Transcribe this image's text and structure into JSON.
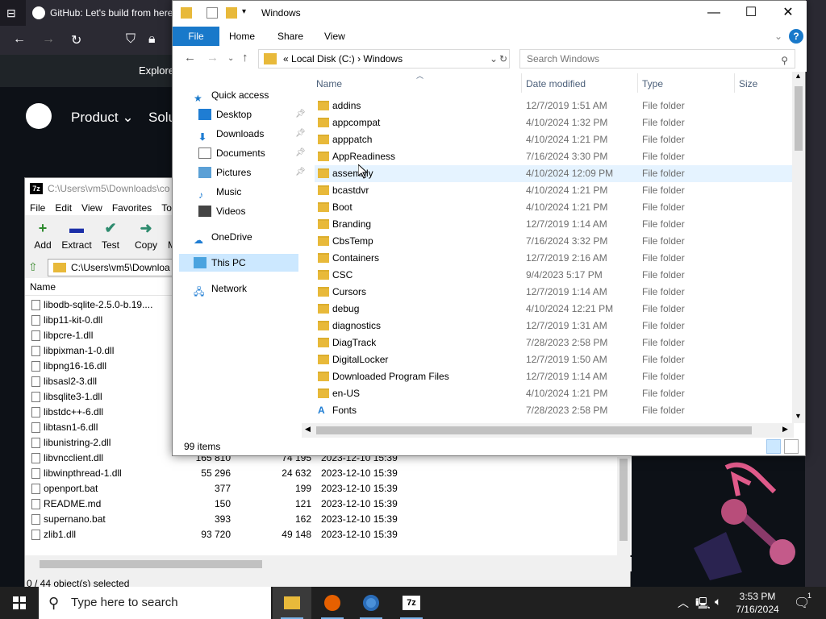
{
  "browser": {
    "tab_title": "GitHub: Let's build from here",
    "explore": "Explore",
    "product": "Product",
    "solutions": "Solu",
    "chevron": "⌄"
  },
  "sevenzip": {
    "title": "C:\\Users\\vm5\\Downloads\\co",
    "logo": "7z",
    "menu": [
      "File",
      "Edit",
      "View",
      "Favorites",
      "To"
    ],
    "tools": [
      {
        "label": "Add",
        "glyph": "+",
        "color": "#2e8b2e"
      },
      {
        "label": "Extract",
        "glyph": "▬",
        "color": "#1b2fa8"
      },
      {
        "label": "Test",
        "glyph": "✔",
        "color": "#2e8b6e"
      },
      {
        "label": "Copy",
        "glyph": "➜",
        "color": "#2e8b6e"
      },
      {
        "label": "M",
        "glyph": "",
        "color": "#000"
      }
    ],
    "path": "C:\\Users\\vm5\\Downloa",
    "column_name": "Name",
    "rows": [
      {
        "name": "libodb-sqlite-2.5.0-b.19....",
        "size": "",
        "packed": "",
        "date": ""
      },
      {
        "name": "libp11-kit-0.dll",
        "size": "",
        "packed": "",
        "date": ""
      },
      {
        "name": "libpcre-1.dll",
        "size": "",
        "packed": "",
        "date": ""
      },
      {
        "name": "libpixman-1-0.dll",
        "size": "",
        "packed": "",
        "date": ""
      },
      {
        "name": "libpng16-16.dll",
        "size": "",
        "packed": "",
        "date": ""
      },
      {
        "name": "libsasl2-3.dll",
        "size": "",
        "packed": "",
        "date": ""
      },
      {
        "name": "libsqlite3-1.dll",
        "size": "",
        "packed": "",
        "date": ""
      },
      {
        "name": "libstdc++-6.dll",
        "size": "",
        "packed": "",
        "date": ""
      },
      {
        "name": "libtasn1-6.dll",
        "size": "",
        "packed": "",
        "date": ""
      },
      {
        "name": "libunistring-2.dll",
        "size": "",
        "packed": "",
        "date": ""
      },
      {
        "name": "libvncclient.dll",
        "size": "165 810",
        "packed": "74 195",
        "date": "2023-12-10 15:39"
      },
      {
        "name": "libwinpthread-1.dll",
        "size": "55 296",
        "packed": "24 632",
        "date": "2023-12-10 15:39"
      },
      {
        "name": "openport.bat",
        "size": "377",
        "packed": "199",
        "date": "2023-12-10 15:39"
      },
      {
        "name": "README.md",
        "size": "150",
        "packed": "121",
        "date": "2023-12-10 15:39"
      },
      {
        "name": "supernano.bat",
        "size": "393",
        "packed": "162",
        "date": "2023-12-10 15:39"
      },
      {
        "name": "zlib1.dll",
        "size": "93 720",
        "packed": "49 148",
        "date": "2023-12-10 15:39"
      }
    ],
    "status": "0 / 44 object(s) selected"
  },
  "explorer": {
    "title": "Windows",
    "ribbon_tabs": {
      "file": "File",
      "home": "Home",
      "share": "Share",
      "view": "View"
    },
    "help": "?",
    "address": {
      "prefix": "«",
      "drive": "Local Disk (C:)",
      "sep": "›",
      "folder": "Windows"
    },
    "search_placeholder": "Search Windows",
    "nav": {
      "quick_access": "Quick access",
      "desktop": "Desktop",
      "downloads": "Downloads",
      "documents": "Documents",
      "pictures": "Pictures",
      "music": "Music",
      "videos": "Videos",
      "onedrive": "OneDrive",
      "this_pc": "This PC",
      "network": "Network"
    },
    "columns": {
      "name": "Name",
      "date": "Date modified",
      "type": "Type",
      "size": "Size"
    },
    "files": [
      {
        "name": "addins",
        "date": "12/7/2019 1:51 AM",
        "type": "File folder"
      },
      {
        "name": "appcompat",
        "date": "4/10/2024 1:32 PM",
        "type": "File folder"
      },
      {
        "name": "apppatch",
        "date": "4/10/2024 1:21 PM",
        "type": "File folder"
      },
      {
        "name": "AppReadiness",
        "date": "7/16/2024 3:30 PM",
        "type": "File folder"
      },
      {
        "name": "assembly",
        "date": "4/10/2024 12:09 PM",
        "type": "File folder"
      },
      {
        "name": "bcastdvr",
        "date": "4/10/2024 1:21 PM",
        "type": "File folder"
      },
      {
        "name": "Boot",
        "date": "4/10/2024 1:21 PM",
        "type": "File folder"
      },
      {
        "name": "Branding",
        "date": "12/7/2019 1:14 AM",
        "type": "File folder"
      },
      {
        "name": "CbsTemp",
        "date": "7/16/2024 3:32 PM",
        "type": "File folder"
      },
      {
        "name": "Containers",
        "date": "12/7/2019 2:16 AM",
        "type": "File folder"
      },
      {
        "name": "CSC",
        "date": "9/4/2023 5:17 PM",
        "type": "File folder"
      },
      {
        "name": "Cursors",
        "date": "12/7/2019 1:14 AM",
        "type": "File folder"
      },
      {
        "name": "debug",
        "date": "4/10/2024 12:21 PM",
        "type": "File folder"
      },
      {
        "name": "diagnostics",
        "date": "12/7/2019 1:31 AM",
        "type": "File folder"
      },
      {
        "name": "DiagTrack",
        "date": "7/28/2023 2:58 PM",
        "type": "File folder"
      },
      {
        "name": "DigitalLocker",
        "date": "12/7/2019 1:50 AM",
        "type": "File folder"
      },
      {
        "name": "Downloaded Program Files",
        "date": "12/7/2019 1:14 AM",
        "type": "File folder"
      },
      {
        "name": "en-US",
        "date": "4/10/2024 1:21 PM",
        "type": "File folder"
      },
      {
        "name": "Fonts",
        "date": "7/28/2023 2:58 PM",
        "type": "File folder"
      }
    ],
    "status": "99 items"
  },
  "taskbar": {
    "search_placeholder": "Type here to search",
    "time": "3:53 PM",
    "date": "7/16/2024",
    "sevenzip_label": "7z"
  }
}
